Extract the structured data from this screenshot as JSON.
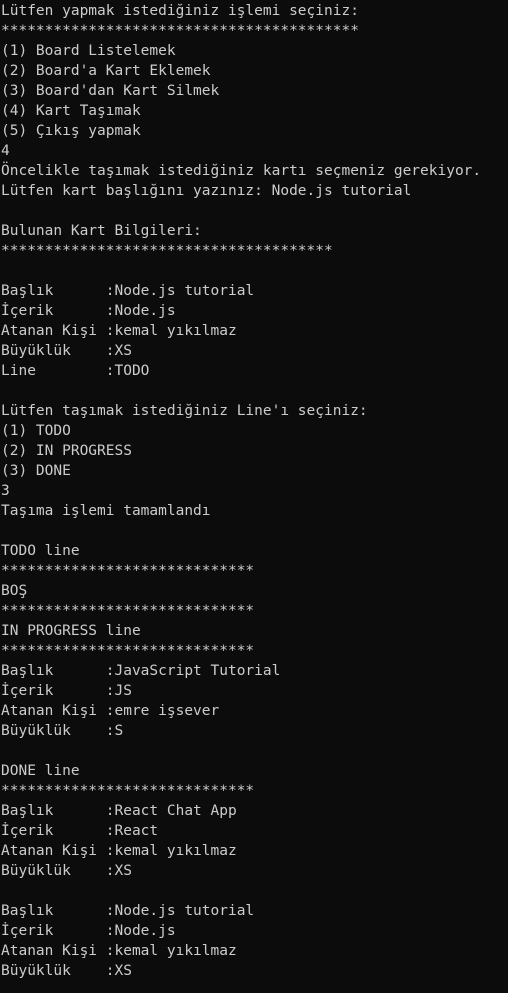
{
  "window": {
    "background_color": "#0c0c0c",
    "text_color": "#cccccc"
  },
  "lines": [
    "Lütfen yapmak istediğiniz işlemi seçiniz:",
    "*****************************************",
    "(1) Board Listelemek",
    "(2) Board'a Kart Eklemek",
    "(3) Board'dan Kart Silmek",
    "(4) Kart Taşımak",
    "(5) Çıkış yapmak",
    "4",
    "Öncelikle taşımak istediğiniz kartı seçmeniz gerekiyor.",
    "Lütfen kart başlığını yazınız: Node.js tutorial",
    "",
    "Bulunan Kart Bilgileri:",
    "**************************************",
    "",
    "Başlık      :Node.js tutorial",
    "İçerik      :Node.js",
    "Atanan Kişi :kemal yıkılmaz",
    "Büyüklük    :XS",
    "Line        :TODO",
    "",
    "Lütfen taşımak istediğiniz Line'ı seçiniz:",
    "(1) TODO",
    "(2) IN PROGRESS",
    "(3) DONE",
    "3",
    "Taşıma işlemi tamamlandı",
    "",
    "TODO line",
    "*****************************",
    "BOŞ",
    "*****************************",
    "IN PROGRESS line",
    "*****************************",
    "Başlık      :JavaScript Tutorial",
    "İçerik      :JS",
    "Atanan Kişi :emre işsever",
    "Büyüklük    :S",
    "",
    "DONE line",
    "*****************************",
    "Başlık      :React Chat App",
    "İçerik      :React",
    "Atanan Kişi :kemal yıkılmaz",
    "Büyüklük    :XS",
    "",
    "Başlık      :Node.js tutorial",
    "İçerik      :Node.js",
    "Atanan Kişi :kemal yıkılmaz",
    "Büyüklük    :XS"
  ]
}
